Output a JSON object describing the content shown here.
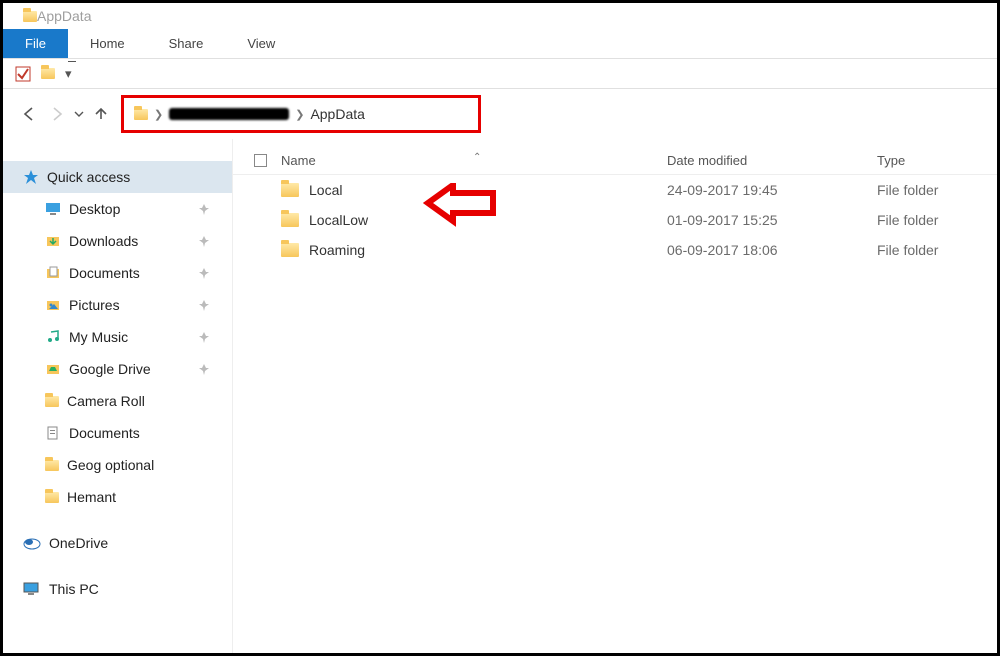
{
  "window": {
    "title": "AppData"
  },
  "ribbon": {
    "file": "File",
    "home": "Home",
    "share": "Share",
    "view": "View"
  },
  "breadcrumb": {
    "current": "AppData"
  },
  "columns": {
    "name": "Name",
    "date": "Date modified",
    "type": "Type"
  },
  "sidebar": {
    "quick_access": "Quick access",
    "items": [
      {
        "label": "Desktop",
        "pinned": true,
        "icon": "desktop"
      },
      {
        "label": "Downloads",
        "pinned": true,
        "icon": "downloads"
      },
      {
        "label": "Documents",
        "pinned": true,
        "icon": "documents"
      },
      {
        "label": "Pictures",
        "pinned": true,
        "icon": "pictures"
      },
      {
        "label": "My Music",
        "pinned": true,
        "icon": "music"
      },
      {
        "label": "Google Drive",
        "pinned": true,
        "icon": "gdrive"
      },
      {
        "label": "Camera Roll",
        "pinned": false,
        "icon": "folder"
      },
      {
        "label": "Documents",
        "pinned": false,
        "icon": "documents-alt"
      },
      {
        "label": "Geog optional",
        "pinned": false,
        "icon": "folder"
      },
      {
        "label": "Hemant",
        "pinned": false,
        "icon": "folder"
      }
    ],
    "onedrive": "OneDrive",
    "this_pc": "This PC"
  },
  "rows": [
    {
      "name": "Local",
      "date": "24-09-2017 19:45",
      "type": "File folder"
    },
    {
      "name": "LocalLow",
      "date": "01-09-2017 15:25",
      "type": "File folder"
    },
    {
      "name": "Roaming",
      "date": "06-09-2017 18:06",
      "type": "File folder"
    }
  ]
}
